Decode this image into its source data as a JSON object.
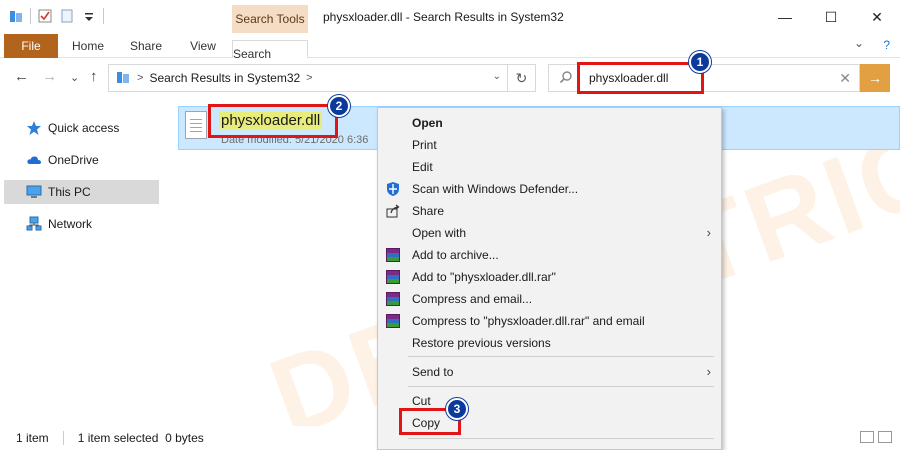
{
  "window": {
    "title": "physxloader.dll - Search Results in System32",
    "minimize": "—",
    "maximize": "☐",
    "close": "✕"
  },
  "ribbon": {
    "context_group": "Search Tools",
    "tabs": [
      "File",
      "Home",
      "Share",
      "View",
      "Search"
    ],
    "help": "?",
    "collapse": "⌄"
  },
  "address": {
    "back": "←",
    "forward": "→",
    "dropdown": "⌄",
    "up": "↑",
    "path": "Search Results in System32",
    "chevron": ">",
    "refresh": "↻",
    "drop": "⌄"
  },
  "search": {
    "value": "physxloader.dll",
    "clear": "✕",
    "go": "→"
  },
  "sidebar": {
    "items": [
      "Quick access",
      "OneDrive",
      "This PC",
      "Network"
    ],
    "selected": "This PC"
  },
  "file": {
    "name": "physxloader.dll",
    "meta": "Date modified: 5/21/2020 6:36"
  },
  "context_menu": {
    "items": [
      {
        "label": "Open",
        "icon": "none"
      },
      {
        "label": "Print",
        "icon": "none"
      },
      {
        "label": "Edit",
        "icon": "none"
      },
      {
        "label": "Scan with Windows Defender...",
        "icon": "defender-icon"
      },
      {
        "label": "Share",
        "icon": "share-icon"
      },
      {
        "label": "Open with",
        "icon": "none",
        "submenu": "›"
      },
      {
        "label": "Add to archive...",
        "icon": "winrar-icon"
      },
      {
        "label": "Add to \"physxloader.dll.rar\"",
        "icon": "winrar-icon"
      },
      {
        "label": "Compress and email...",
        "icon": "winrar-icon"
      },
      {
        "label": "Compress to \"physxloader.dll.rar\" and email",
        "icon": "winrar-icon"
      },
      {
        "label": "Restore previous versions",
        "icon": "none"
      },
      {
        "label": "Send to",
        "icon": "none",
        "submenu": "›"
      },
      {
        "label": "Cut",
        "icon": "none"
      },
      {
        "label": "Copy",
        "icon": "none"
      }
    ]
  },
  "status": {
    "items": "1 item",
    "selected": "1 item selected  0 bytes"
  },
  "annotations": {
    "badges": [
      "1",
      "2",
      "3"
    ],
    "color": "#e01515",
    "badge_color": "#0c3a9c"
  },
  "watermark": "DEVICETRICKS"
}
